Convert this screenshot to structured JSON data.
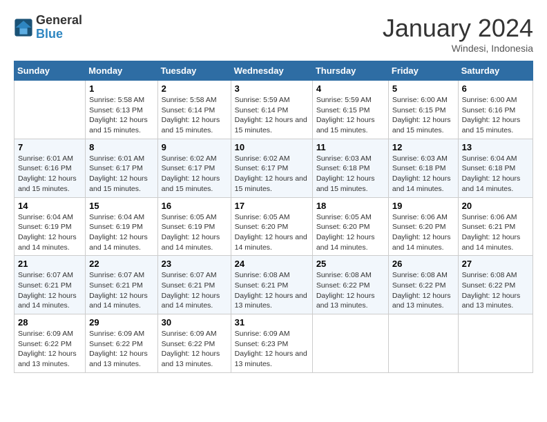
{
  "header": {
    "logo_line1": "General",
    "logo_line2": "Blue",
    "month_title": "January 2024",
    "location": "Windesi, Indonesia"
  },
  "weekdays": [
    "Sunday",
    "Monday",
    "Tuesday",
    "Wednesday",
    "Thursday",
    "Friday",
    "Saturday"
  ],
  "weeks": [
    [
      {
        "day": "",
        "sunrise": "",
        "sunset": "",
        "daylight": ""
      },
      {
        "day": "1",
        "sunrise": "Sunrise: 5:58 AM",
        "sunset": "Sunset: 6:13 PM",
        "daylight": "Daylight: 12 hours and 15 minutes."
      },
      {
        "day": "2",
        "sunrise": "Sunrise: 5:58 AM",
        "sunset": "Sunset: 6:14 PM",
        "daylight": "Daylight: 12 hours and 15 minutes."
      },
      {
        "day": "3",
        "sunrise": "Sunrise: 5:59 AM",
        "sunset": "Sunset: 6:14 PM",
        "daylight": "Daylight: 12 hours and 15 minutes."
      },
      {
        "day": "4",
        "sunrise": "Sunrise: 5:59 AM",
        "sunset": "Sunset: 6:15 PM",
        "daylight": "Daylight: 12 hours and 15 minutes."
      },
      {
        "day": "5",
        "sunrise": "Sunrise: 6:00 AM",
        "sunset": "Sunset: 6:15 PM",
        "daylight": "Daylight: 12 hours and 15 minutes."
      },
      {
        "day": "6",
        "sunrise": "Sunrise: 6:00 AM",
        "sunset": "Sunset: 6:16 PM",
        "daylight": "Daylight: 12 hours and 15 minutes."
      }
    ],
    [
      {
        "day": "7",
        "sunrise": "Sunrise: 6:01 AM",
        "sunset": "Sunset: 6:16 PM",
        "daylight": "Daylight: 12 hours and 15 minutes."
      },
      {
        "day": "8",
        "sunrise": "Sunrise: 6:01 AM",
        "sunset": "Sunset: 6:17 PM",
        "daylight": "Daylight: 12 hours and 15 minutes."
      },
      {
        "day": "9",
        "sunrise": "Sunrise: 6:02 AM",
        "sunset": "Sunset: 6:17 PM",
        "daylight": "Daylight: 12 hours and 15 minutes."
      },
      {
        "day": "10",
        "sunrise": "Sunrise: 6:02 AM",
        "sunset": "Sunset: 6:17 PM",
        "daylight": "Daylight: 12 hours and 15 minutes."
      },
      {
        "day": "11",
        "sunrise": "Sunrise: 6:03 AM",
        "sunset": "Sunset: 6:18 PM",
        "daylight": "Daylight: 12 hours and 15 minutes."
      },
      {
        "day": "12",
        "sunrise": "Sunrise: 6:03 AM",
        "sunset": "Sunset: 6:18 PM",
        "daylight": "Daylight: 12 hours and 14 minutes."
      },
      {
        "day": "13",
        "sunrise": "Sunrise: 6:04 AM",
        "sunset": "Sunset: 6:18 PM",
        "daylight": "Daylight: 12 hours and 14 minutes."
      }
    ],
    [
      {
        "day": "14",
        "sunrise": "Sunrise: 6:04 AM",
        "sunset": "Sunset: 6:19 PM",
        "daylight": "Daylight: 12 hours and 14 minutes."
      },
      {
        "day": "15",
        "sunrise": "Sunrise: 6:04 AM",
        "sunset": "Sunset: 6:19 PM",
        "daylight": "Daylight: 12 hours and 14 minutes."
      },
      {
        "day": "16",
        "sunrise": "Sunrise: 6:05 AM",
        "sunset": "Sunset: 6:19 PM",
        "daylight": "Daylight: 12 hours and 14 minutes."
      },
      {
        "day": "17",
        "sunrise": "Sunrise: 6:05 AM",
        "sunset": "Sunset: 6:20 PM",
        "daylight": "Daylight: 12 hours and 14 minutes."
      },
      {
        "day": "18",
        "sunrise": "Sunrise: 6:05 AM",
        "sunset": "Sunset: 6:20 PM",
        "daylight": "Daylight: 12 hours and 14 minutes."
      },
      {
        "day": "19",
        "sunrise": "Sunrise: 6:06 AM",
        "sunset": "Sunset: 6:20 PM",
        "daylight": "Daylight: 12 hours and 14 minutes."
      },
      {
        "day": "20",
        "sunrise": "Sunrise: 6:06 AM",
        "sunset": "Sunset: 6:21 PM",
        "daylight": "Daylight: 12 hours and 14 minutes."
      }
    ],
    [
      {
        "day": "21",
        "sunrise": "Sunrise: 6:07 AM",
        "sunset": "Sunset: 6:21 PM",
        "daylight": "Daylight: 12 hours and 14 minutes."
      },
      {
        "day": "22",
        "sunrise": "Sunrise: 6:07 AM",
        "sunset": "Sunset: 6:21 PM",
        "daylight": "Daylight: 12 hours and 14 minutes."
      },
      {
        "day": "23",
        "sunrise": "Sunrise: 6:07 AM",
        "sunset": "Sunset: 6:21 PM",
        "daylight": "Daylight: 12 hours and 14 minutes."
      },
      {
        "day": "24",
        "sunrise": "Sunrise: 6:08 AM",
        "sunset": "Sunset: 6:21 PM",
        "daylight": "Daylight: 12 hours and 13 minutes."
      },
      {
        "day": "25",
        "sunrise": "Sunrise: 6:08 AM",
        "sunset": "Sunset: 6:22 PM",
        "daylight": "Daylight: 12 hours and 13 minutes."
      },
      {
        "day": "26",
        "sunrise": "Sunrise: 6:08 AM",
        "sunset": "Sunset: 6:22 PM",
        "daylight": "Daylight: 12 hours and 13 minutes."
      },
      {
        "day": "27",
        "sunrise": "Sunrise: 6:08 AM",
        "sunset": "Sunset: 6:22 PM",
        "daylight": "Daylight: 12 hours and 13 minutes."
      }
    ],
    [
      {
        "day": "28",
        "sunrise": "Sunrise: 6:09 AM",
        "sunset": "Sunset: 6:22 PM",
        "daylight": "Daylight: 12 hours and 13 minutes."
      },
      {
        "day": "29",
        "sunrise": "Sunrise: 6:09 AM",
        "sunset": "Sunset: 6:22 PM",
        "daylight": "Daylight: 12 hours and 13 minutes."
      },
      {
        "day": "30",
        "sunrise": "Sunrise: 6:09 AM",
        "sunset": "Sunset: 6:22 PM",
        "daylight": "Daylight: 12 hours and 13 minutes."
      },
      {
        "day": "31",
        "sunrise": "Sunrise: 6:09 AM",
        "sunset": "Sunset: 6:23 PM",
        "daylight": "Daylight: 12 hours and 13 minutes."
      },
      {
        "day": "",
        "sunrise": "",
        "sunset": "",
        "daylight": ""
      },
      {
        "day": "",
        "sunrise": "",
        "sunset": "",
        "daylight": ""
      },
      {
        "day": "",
        "sunrise": "",
        "sunset": "",
        "daylight": ""
      }
    ]
  ]
}
